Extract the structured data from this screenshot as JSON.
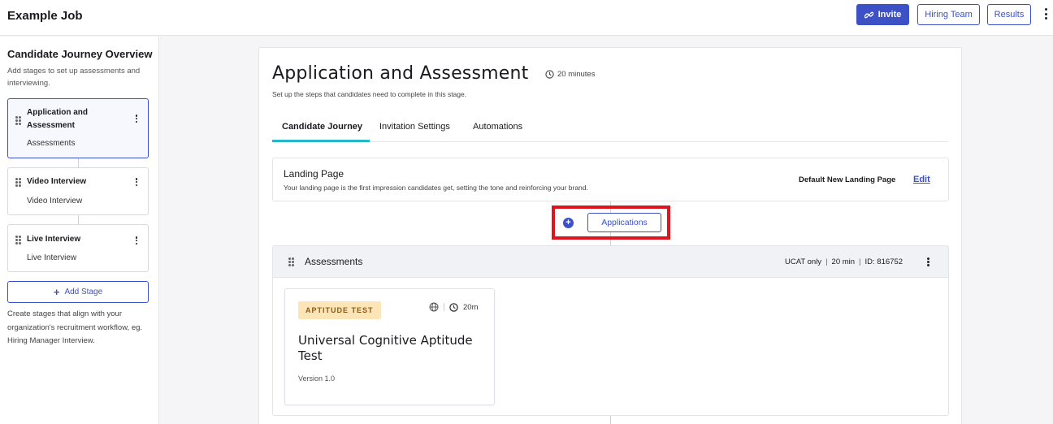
{
  "header": {
    "job_title": "Example Job",
    "invite_label": "Invite",
    "hiring_team_label": "Hiring Team",
    "results_label": "Results"
  },
  "sidebar": {
    "title": "Candidate Journey Overview",
    "description": "Add stages to set up assessments and interviewing.",
    "stages": [
      {
        "name": "Application and Assessment",
        "sub": "Assessments",
        "active": true
      },
      {
        "name": "Video Interview",
        "sub": "Video Interview",
        "active": false
      },
      {
        "name": "Live Interview",
        "sub": "Live Interview",
        "active": false
      }
    ],
    "add_stage_label": "Add Stage",
    "help_text": "Create stages that align with your organization's recruitment workflow, eg. Hiring Manager Interview."
  },
  "main": {
    "title": "Application and Assessment",
    "duration": "20 minutes",
    "subtitle": "Set up the steps that candidates need to complete in this stage.",
    "tabs": [
      {
        "label": "Candidate Journey",
        "active": true
      },
      {
        "label": "Invitation Settings",
        "active": false
      },
      {
        "label": "Automations",
        "active": false
      }
    ],
    "landing": {
      "title": "Landing Page",
      "description": "Your landing page is the first impression candidates get, setting the tone and reinforcing your brand.",
      "page_name": "Default New Landing Page",
      "edit_label": "Edit"
    },
    "add_step": {
      "button_label": "Applications"
    },
    "assessments": {
      "title": "Assessments",
      "meta": [
        "UCAT only",
        "20 min",
        "ID: 816752"
      ],
      "test": {
        "badge": "APTITUDE TEST",
        "duration": "20m",
        "title": "Universal Cognitive Aptitude Test",
        "version": "Version 1.0"
      }
    }
  },
  "colors": {
    "accent": "#3d51c7",
    "tab_underline": "#27b8c8",
    "highlight": "#e0141f",
    "badge_bg": "#fde5b8"
  }
}
